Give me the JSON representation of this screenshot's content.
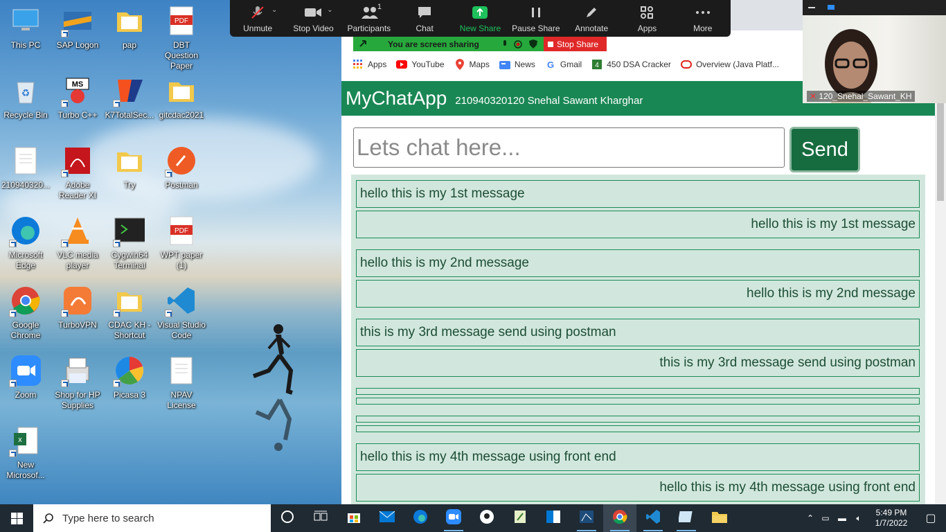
{
  "desktop": {
    "icons": [
      {
        "label": "This PC",
        "icon": "computer-icon"
      },
      {
        "label": "SAP Logon",
        "icon": "sap-icon"
      },
      {
        "label": "pap",
        "icon": "folder-icon"
      },
      {
        "label": "DBT Question Paper",
        "icon": "pdf-icon"
      },
      {
        "label": "Recycle Bin",
        "icon": "recycle-bin-icon"
      },
      {
        "label": "Turbo C++",
        "icon": "turbo-cpp-icon"
      },
      {
        "label": "K7TotalSec...",
        "icon": "k7-icon"
      },
      {
        "label": "gitcdac2021",
        "icon": "folder-icon"
      },
      {
        "label": "210940320...",
        "icon": "document-icon"
      },
      {
        "label": "Adobe Reader XI",
        "icon": "adobe-reader-icon"
      },
      {
        "label": "Try",
        "icon": "folder-icon"
      },
      {
        "label": "Postman",
        "icon": "postman-icon"
      },
      {
        "label": "Microsoft Edge",
        "icon": "edge-icon"
      },
      {
        "label": "VLC media player",
        "icon": "vlc-icon"
      },
      {
        "label": "Cygwin64 Terminal",
        "icon": "terminal-icon"
      },
      {
        "label": "WPT paper (1)",
        "icon": "pdf-icon"
      },
      {
        "label": "Google Chrome",
        "icon": "chrome-icon"
      },
      {
        "label": "TurboVPN",
        "icon": "vpn-icon"
      },
      {
        "label": "CDAC KH - Shortcut",
        "icon": "folder-icon"
      },
      {
        "label": "Visual Studio Code",
        "icon": "vscode-icon"
      },
      {
        "label": "Zoom",
        "icon": "zoom-icon"
      },
      {
        "label": "Shop for HP Supplies",
        "icon": "printer-icon"
      },
      {
        "label": "Picasa 3",
        "icon": "picasa-icon"
      },
      {
        "label": "NPAV License",
        "icon": "document-icon"
      },
      {
        "label": "New Microsof...",
        "icon": "excel-icon"
      }
    ],
    "pdf_badge": "PDF"
  },
  "zoom": {
    "tools": [
      {
        "label": "Unmute",
        "icon": "muted-mic-icon"
      },
      {
        "label": "Stop Video",
        "icon": "video-camera-icon"
      },
      {
        "label": "Participants",
        "icon": "participants-icon",
        "count": "1"
      },
      {
        "label": "Chat",
        "icon": "chat-icon"
      },
      {
        "label": "New Share",
        "icon": "share-arrow-icon"
      },
      {
        "label": "Pause Share",
        "icon": "pause-icon"
      },
      {
        "label": "Annotate",
        "icon": "pen-icon"
      },
      {
        "label": "Apps",
        "icon": "apps-icon"
      },
      {
        "label": "More",
        "icon": "more-icon"
      }
    ],
    "sharing_banner": "You are screen sharing",
    "stop_share": "Stop Share",
    "participant_name": "120_Snehal_Sawant_KH"
  },
  "browser": {
    "bookmarks": [
      {
        "label": "Apps",
        "icon": "apps-grid-icon"
      },
      {
        "label": "YouTube",
        "icon": "youtube-icon"
      },
      {
        "label": "Maps",
        "icon": "maps-icon"
      },
      {
        "label": "News",
        "icon": "news-icon"
      },
      {
        "label": "Gmail",
        "icon": "google-icon"
      },
      {
        "label": "450 DSA Cracker",
        "icon": "dsa-icon"
      },
      {
        "label": "Overview (Java Platf...",
        "icon": "oracle-icon"
      }
    ]
  },
  "app": {
    "brand": "MyChatApp",
    "user_info": "210940320120 Snehal Sawant Kharghar",
    "input_placeholder": "Lets chat here...",
    "send_label": "Send",
    "messages": [
      {
        "text": "hello this is my 1st message",
        "align": "left"
      },
      {
        "text": "hello this is my 1st message",
        "align": "right"
      },
      {
        "text": "hello this is my 2nd message",
        "align": "left"
      },
      {
        "text": "hello this is my 2nd message",
        "align": "right"
      },
      {
        "text": "this is my 3rd message send using postman",
        "align": "left"
      },
      {
        "text": "this is my 3rd message send using postman",
        "align": "right"
      },
      {
        "text": "",
        "align": "left"
      },
      {
        "text": "",
        "align": "right"
      },
      {
        "text": "",
        "align": "left"
      },
      {
        "text": "",
        "align": "right"
      },
      {
        "text": "hello this is my 4th message using front end",
        "align": "left"
      },
      {
        "text": "hello this is my 4th message using front end",
        "align": "right"
      }
    ]
  },
  "taskbar": {
    "search_placeholder": "Type here to search",
    "time": "5:49 PM",
    "date": "1/7/2022",
    "apps": [
      "cortana-icon",
      "task-view-icon",
      "store-icon",
      "mail-icon",
      "edge-icon",
      "zoom-icon",
      "keeper-icon",
      "notepad-icon",
      "outlook-icon",
      "network-tool-icon",
      "chrome-icon",
      "vscode-icon",
      "notes-icon",
      "file-explorer-icon"
    ]
  },
  "colors": {
    "navbar": "#198754",
    "send_button": "#176c3f",
    "message_bg": "#d1e7dd",
    "message_border": "#1b8a57",
    "zoom_green": "#1ec15b",
    "stop_share": "#e02828"
  }
}
